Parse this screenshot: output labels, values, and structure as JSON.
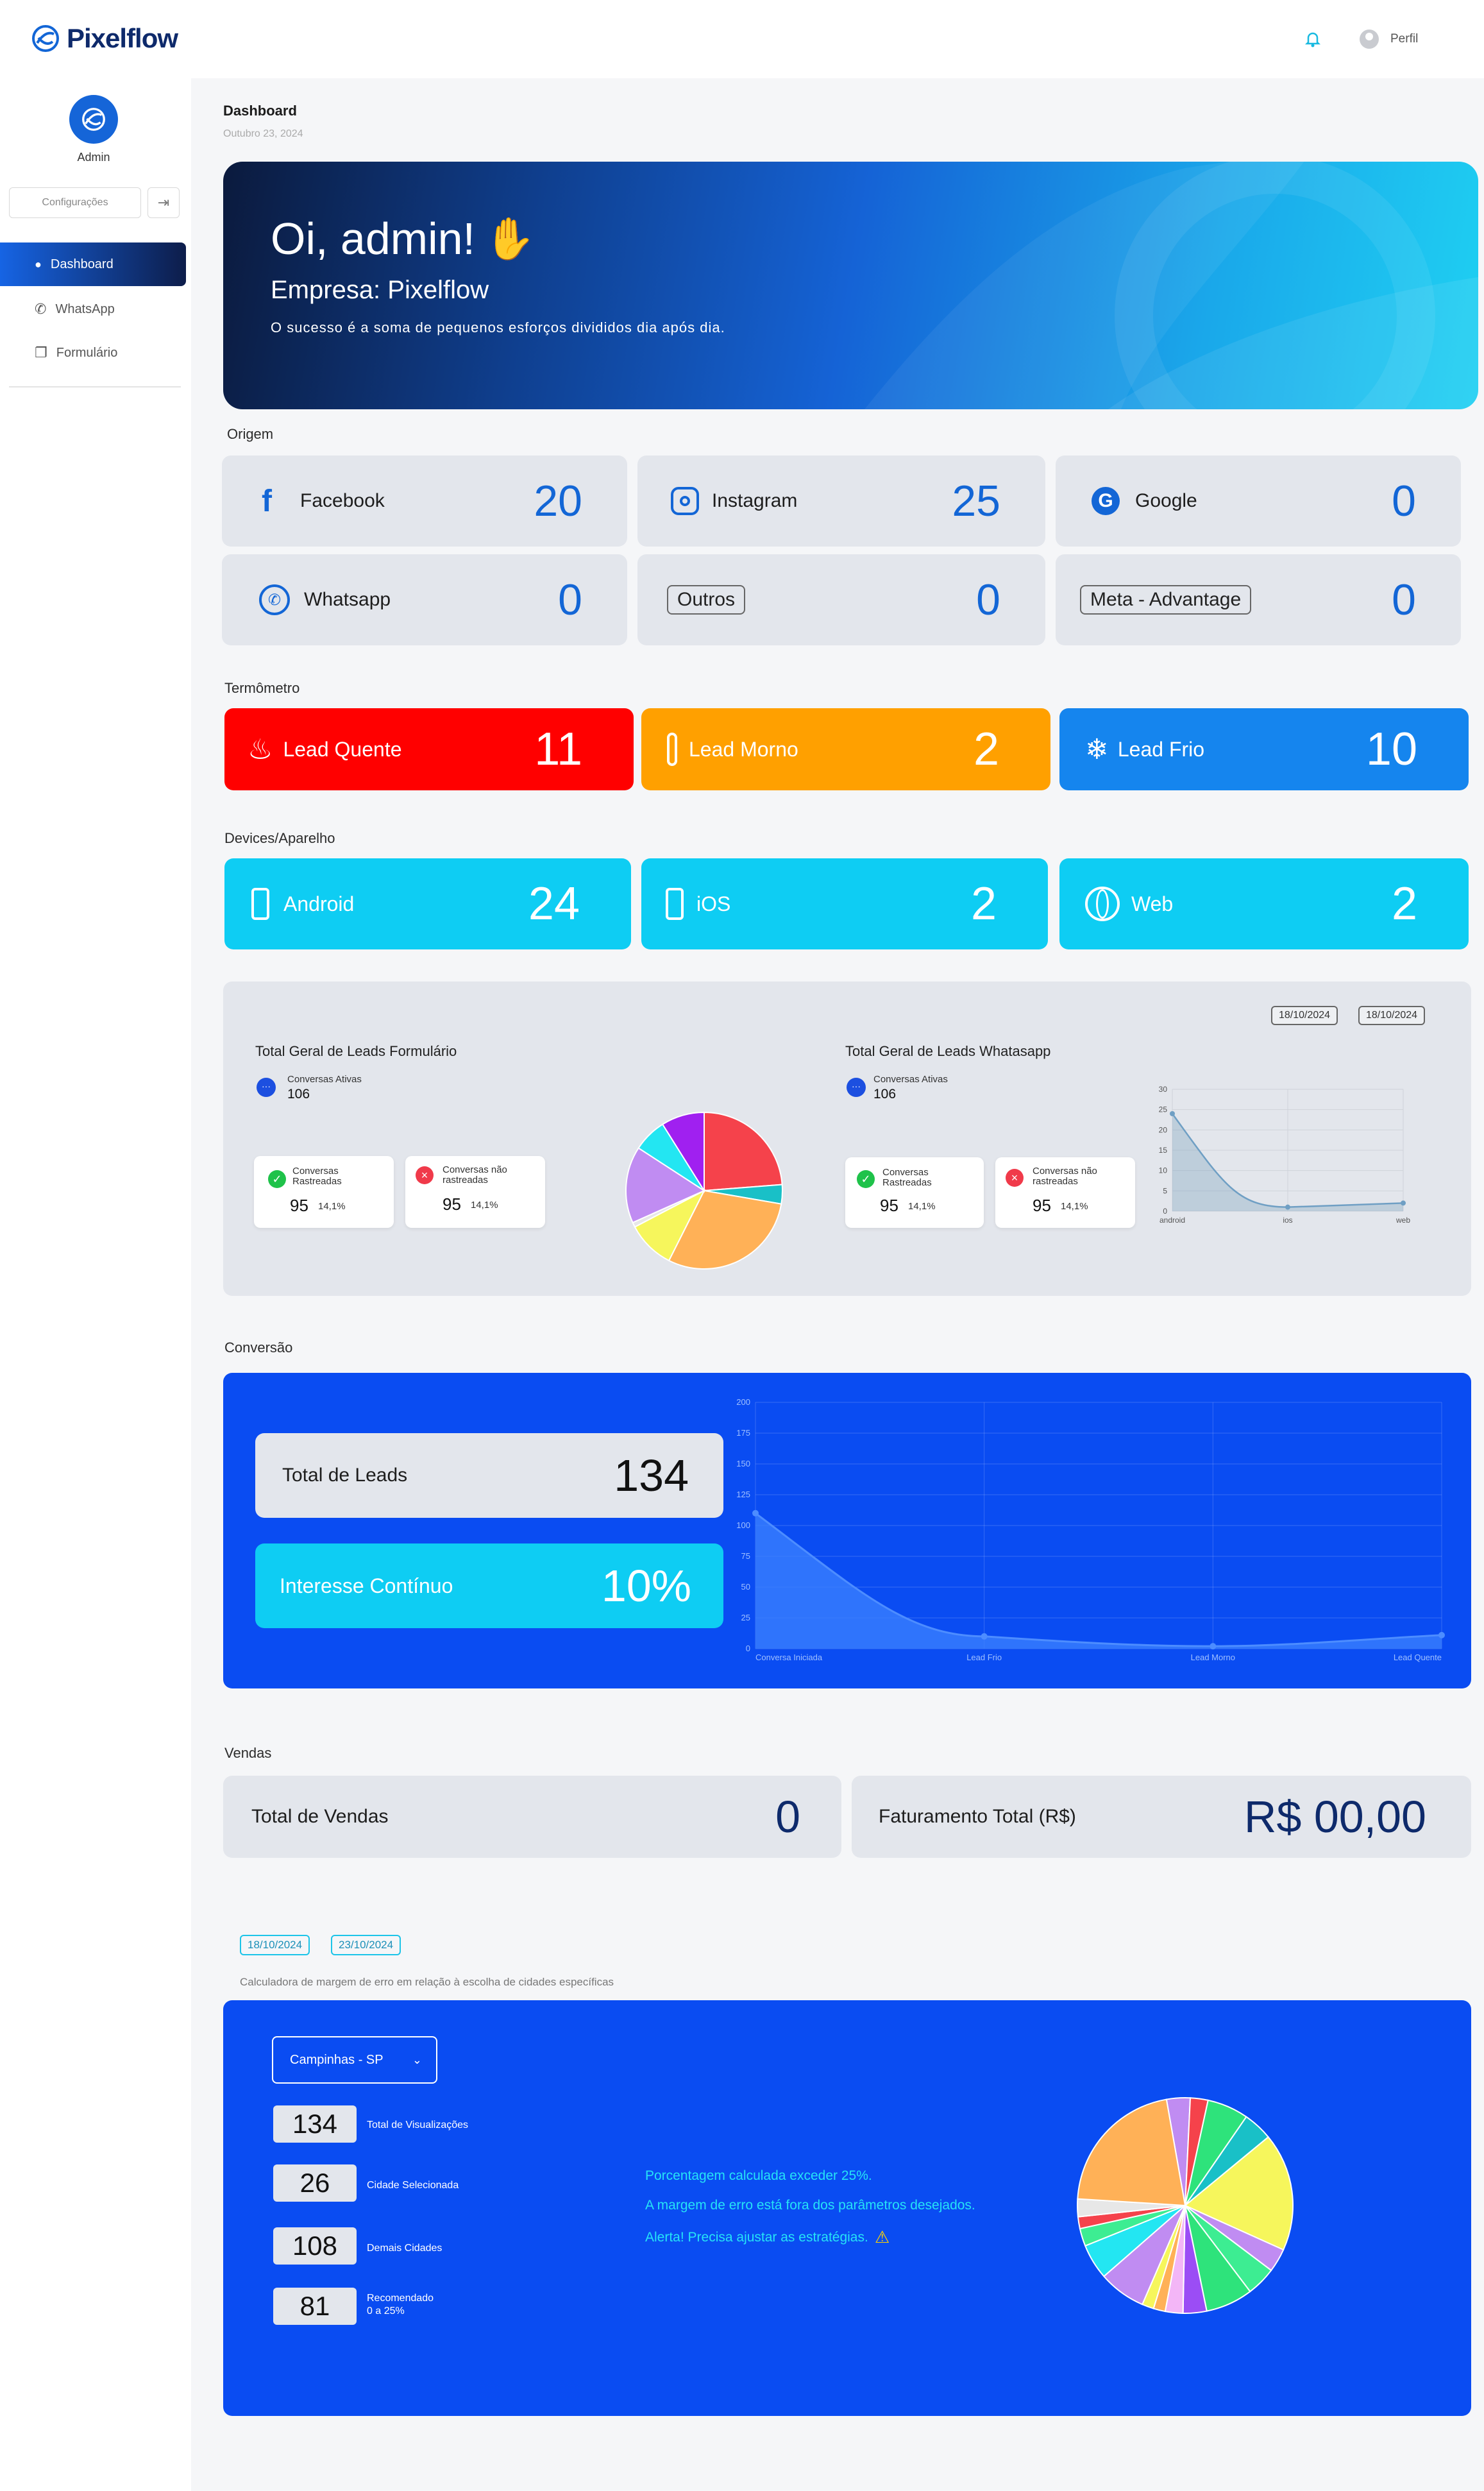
{
  "app": {
    "brand": "Pixelflow",
    "profile_label": "Perfil"
  },
  "sidebar": {
    "user": "Admin",
    "config_label": "Configurações",
    "items": [
      {
        "label": "Dashboard",
        "icon": "users-icon"
      },
      {
        "label": "WhatsApp",
        "icon": "whatsapp-icon"
      },
      {
        "label": "Formulário",
        "icon": "copy-icon"
      }
    ]
  },
  "page": {
    "title": "Dashboard",
    "date": "Outubro 23, 2024"
  },
  "hero": {
    "greeting": "Oi, admin!",
    "company": "Empresa: Pixelflow",
    "motto": "O sucesso é a soma de pequenos esforços divididos dia após dia."
  },
  "origem": {
    "title": "Origem",
    "cards": [
      {
        "label": "Facebook",
        "value": "20"
      },
      {
        "label": "Instagram",
        "value": "25"
      },
      {
        "label": "Google",
        "value": "0"
      },
      {
        "label": "Whatsapp",
        "value": "0"
      },
      {
        "label": "Outros",
        "value": "0"
      },
      {
        "label": "Meta - Advantage",
        "value": "0"
      }
    ]
  },
  "termometro": {
    "title": "Termômetro",
    "cards": [
      {
        "label": "Lead Quente",
        "value": "11",
        "color": "#ff0000"
      },
      {
        "label": "Lead Morno",
        "value": "2",
        "color": "#ffa000"
      },
      {
        "label": "Lead Frio",
        "value": "10",
        "color": "#1585ee"
      }
    ]
  },
  "devices": {
    "title": "Devices/Aparelho",
    "cards": [
      {
        "label": "Android",
        "value": "24"
      },
      {
        "label": "iOS",
        "value": "2"
      },
      {
        "label": "Web",
        "value": "2"
      }
    ]
  },
  "leads_panel": {
    "date_from": "18/10/2024",
    "date_to": "18/10/2024",
    "form": {
      "title": "Total Geral de Leads Formulário",
      "active_label": "Conversas Ativas",
      "active_value": "106",
      "tracked_label": "Conversas Rastreadas",
      "tracked_value": "95",
      "tracked_pct": "14,1%",
      "untracked_label": "Conversas não rastreadas",
      "untracked_value": "95",
      "untracked_pct": "14,1%"
    },
    "whatsapp": {
      "title": "Total Geral de Leads Whatasapp",
      "active_label": "Conversas Ativas",
      "active_value": "106",
      "tracked_label": "Conversas Rastreadas",
      "tracked_value": "95",
      "tracked_pct": "14,1%",
      "untracked_label": "Conversas não rastreadas",
      "untracked_value": "95",
      "untracked_pct": "14,1%"
    }
  },
  "conversao": {
    "title": "Conversão",
    "total_label": "Total de Leads",
    "total_value": "134",
    "interest_label": "Interesse Contínuo",
    "interest_value": "10%"
  },
  "vendas": {
    "title": "Vendas",
    "total_label": "Total de Vendas",
    "total_value": "0",
    "revenue_label": "Faturamento Total (R$)",
    "revenue_value": "R$ 00,00"
  },
  "calc": {
    "date_from": "18/10/2024",
    "date_to": "23/10/2024",
    "caption": "Calculadora de  margem de erro em relação à escolha de cidades específicas",
    "select_value": "Campinhas - SP",
    "stats": [
      {
        "value": "134",
        "label": "Total de Visualizações"
      },
      {
        "value": "26",
        "label": "Cidade Selecionada"
      },
      {
        "value": "108",
        "label": "Demais Cidades"
      },
      {
        "value": "81",
        "label": "Recomendado",
        "label2": "0 a 25%"
      }
    ],
    "alert1": "Porcentagem calculada exceder 25%.",
    "alert2": "A margem de erro está fora dos parâmetros desejados.",
    "alert3": "Alerta! Precisa ajustar as estratégias."
  },
  "chart_data": [
    {
      "type": "pie",
      "name_ref": "form-pie",
      "values": [
        24,
        4,
        30,
        10,
        1,
        16,
        7,
        9
      ],
      "colors": [
        "#f5424b",
        "#19c0c7",
        "#ffb157",
        "#f6f65c",
        "#e7e7e7",
        "#c08cf2",
        "#23e6f2",
        "#a020f0"
      ]
    },
    {
      "type": "line",
      "name_ref": "whatsapp-devices",
      "categories": [
        "android",
        "ios",
        "web"
      ],
      "values": [
        24,
        1,
        2
      ],
      "ylim": [
        0,
        30
      ],
      "yticks": [
        0,
        5,
        10,
        15,
        20,
        25,
        30
      ]
    },
    {
      "type": "area",
      "name_ref": "conversion-funnel",
      "categories": [
        "Conversa Iniciada",
        "Lead Frio",
        "Lead Morno",
        "Lead Quente"
      ],
      "values": [
        110,
        10,
        2,
        11
      ],
      "ylim": [
        0,
        200
      ],
      "yticks": [
        0,
        25,
        50,
        75,
        100,
        125,
        150,
        175,
        200
      ]
    },
    {
      "type": "pie",
      "name_ref": "cities-pie",
      "values": [
        4,
        3,
        7,
        5,
        20,
        4,
        5,
        8,
        4,
        3,
        2,
        2,
        8,
        6,
        3,
        2,
        3,
        24
      ],
      "colors": [
        "#c08cf2",
        "#f5424b",
        "#2ee37b",
        "#19c0c7",
        "#f6f65c",
        "#c08cf2",
        "#3ded92",
        "#2ee37b",
        "#9b4df5",
        "#f3b6f7",
        "#ffb157",
        "#f6f65c",
        "#c08cf2",
        "#23e6f2",
        "#3ded92",
        "#f5424b",
        "#e7e7e7",
        "#ffb157"
      ]
    }
  ]
}
